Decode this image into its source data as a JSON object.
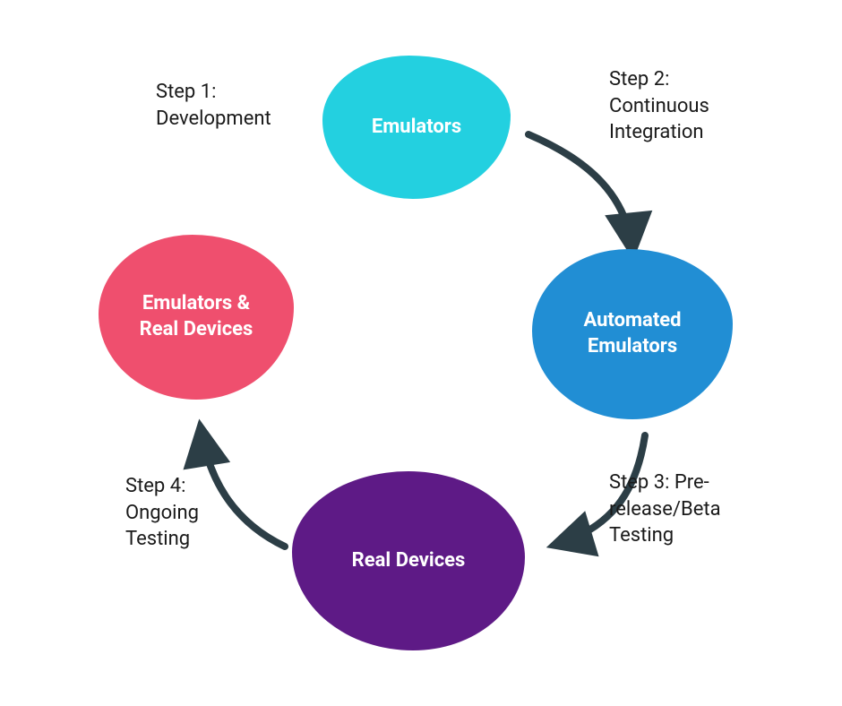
{
  "diagram": {
    "nodes": {
      "top": {
        "label": "Emulators",
        "color": "#23d0e0"
      },
      "right": {
        "label": "Automated\nEmulators",
        "color": "#218ed4"
      },
      "bottom": {
        "label": "Real Devices",
        "color": "#5e1a86"
      },
      "left": {
        "label": "Emulators &\nReal Devices",
        "color": "#ef4f6e"
      }
    },
    "steps": {
      "step1": "Step 1:\nDevelopment",
      "step2": "Step 2:\nContinuous\nIntegration",
      "step3": "Step 3: Pre-\nrelease/Beta\nTesting",
      "step4": "Step 4:\nOngoing\nTesting"
    },
    "arrow_color": "#2c3e46"
  }
}
